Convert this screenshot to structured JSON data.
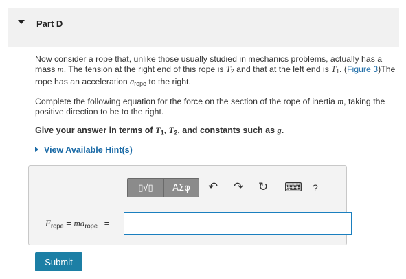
{
  "part": {
    "title": "Part D"
  },
  "problem": {
    "p1_a": "Now consider a rope that, unlike those usually studied in mechanics problems, actually has a mass ",
    "p1_m": "m",
    "p1_b": ". The tension at the right end of this rope is ",
    "p1_c": " and that at the left end is ",
    "p1_d": ". (",
    "figure_link": "Figure 3",
    "p1_e": ")The rope has an acceleration ",
    "p1_f": " to the right.",
    "p2_a": "Complete the following equation for the force on the section of the rope of inertia ",
    "p2_m": "m",
    "p2_b": ", taking the positive direction to be to the right.",
    "p3_a": "Give your answer in terms of ",
    "p3_b": ", and constants such as ",
    "p3_g": "g",
    "p3_c": "."
  },
  "symbols": {
    "T": "T",
    "one": "1",
    "two": "2",
    "a": "a",
    "rope": "rope",
    "comma": ", "
  },
  "hint": {
    "label": "View Available Hint(s)"
  },
  "toolbar": {
    "sqrt_glyph": "▯√▯",
    "greek_label": "ΑΣφ",
    "undo_glyph": "↶",
    "redo_glyph": "↷",
    "reset_glyph": "↻",
    "keyboard_glyph": "⌨",
    "help_label": "?"
  },
  "equation": {
    "F": "F",
    "rope": "rope",
    "eq": " = ",
    "m": "m",
    "a": "a",
    "equals_sign": "="
  },
  "input": {
    "value": ""
  },
  "submit": {
    "label": "Submit"
  }
}
